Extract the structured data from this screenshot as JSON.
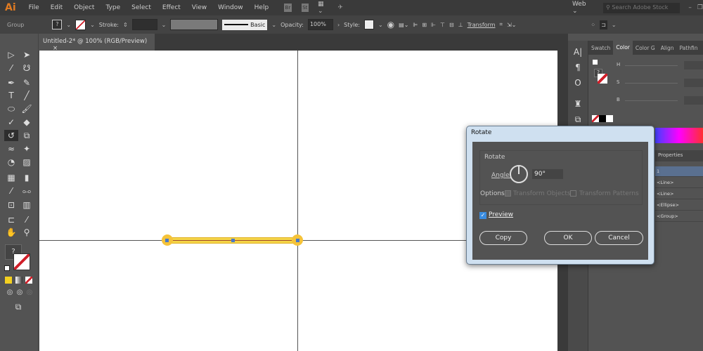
{
  "app": {
    "logo": "Ai",
    "menu": [
      "File",
      "Edit",
      "Object",
      "Type",
      "Select",
      "Effect",
      "View",
      "Window",
      "Help"
    ],
    "bridge": "Br",
    "stock": "St",
    "workspace": "Web",
    "search_placeholder": "Search Adobe Stock"
  },
  "control": {
    "selection": "Group",
    "stroke_label": "Stroke:",
    "brush": "Basic",
    "opacity_label": "Opacity:",
    "opacity": "100%",
    "style_label": "Style:",
    "transform": "Transform"
  },
  "document": {
    "tab": "Untitled-2* @ 100% (RGB/Preview)",
    "close": "×"
  },
  "panel": {
    "tabs": [
      "Swatch",
      "Color",
      "Color G",
      "Align",
      "Pathfin"
    ],
    "active_tab": "Color",
    "h": "H",
    "s": "S",
    "b": "B",
    "properties": "Properties",
    "layers": [
      "1",
      "<Line>",
      "<Line>",
      "<Ellipse>",
      "<Group>"
    ]
  },
  "dialog": {
    "title": "Rotate",
    "group": "Rotate",
    "angle_label": "Angle:",
    "angle": "90°",
    "options_label": "Options:",
    "transform_objects": "Transform Objects",
    "transform_patterns": "Transform Patterns",
    "preview": "Preview",
    "preview_checked": true,
    "copy": "Copy",
    "ok": "OK",
    "cancel": "Cancel"
  },
  "colors": {
    "selection": "#f5d548",
    "accent": "#e07b22",
    "handle": "#4a7ac8"
  }
}
